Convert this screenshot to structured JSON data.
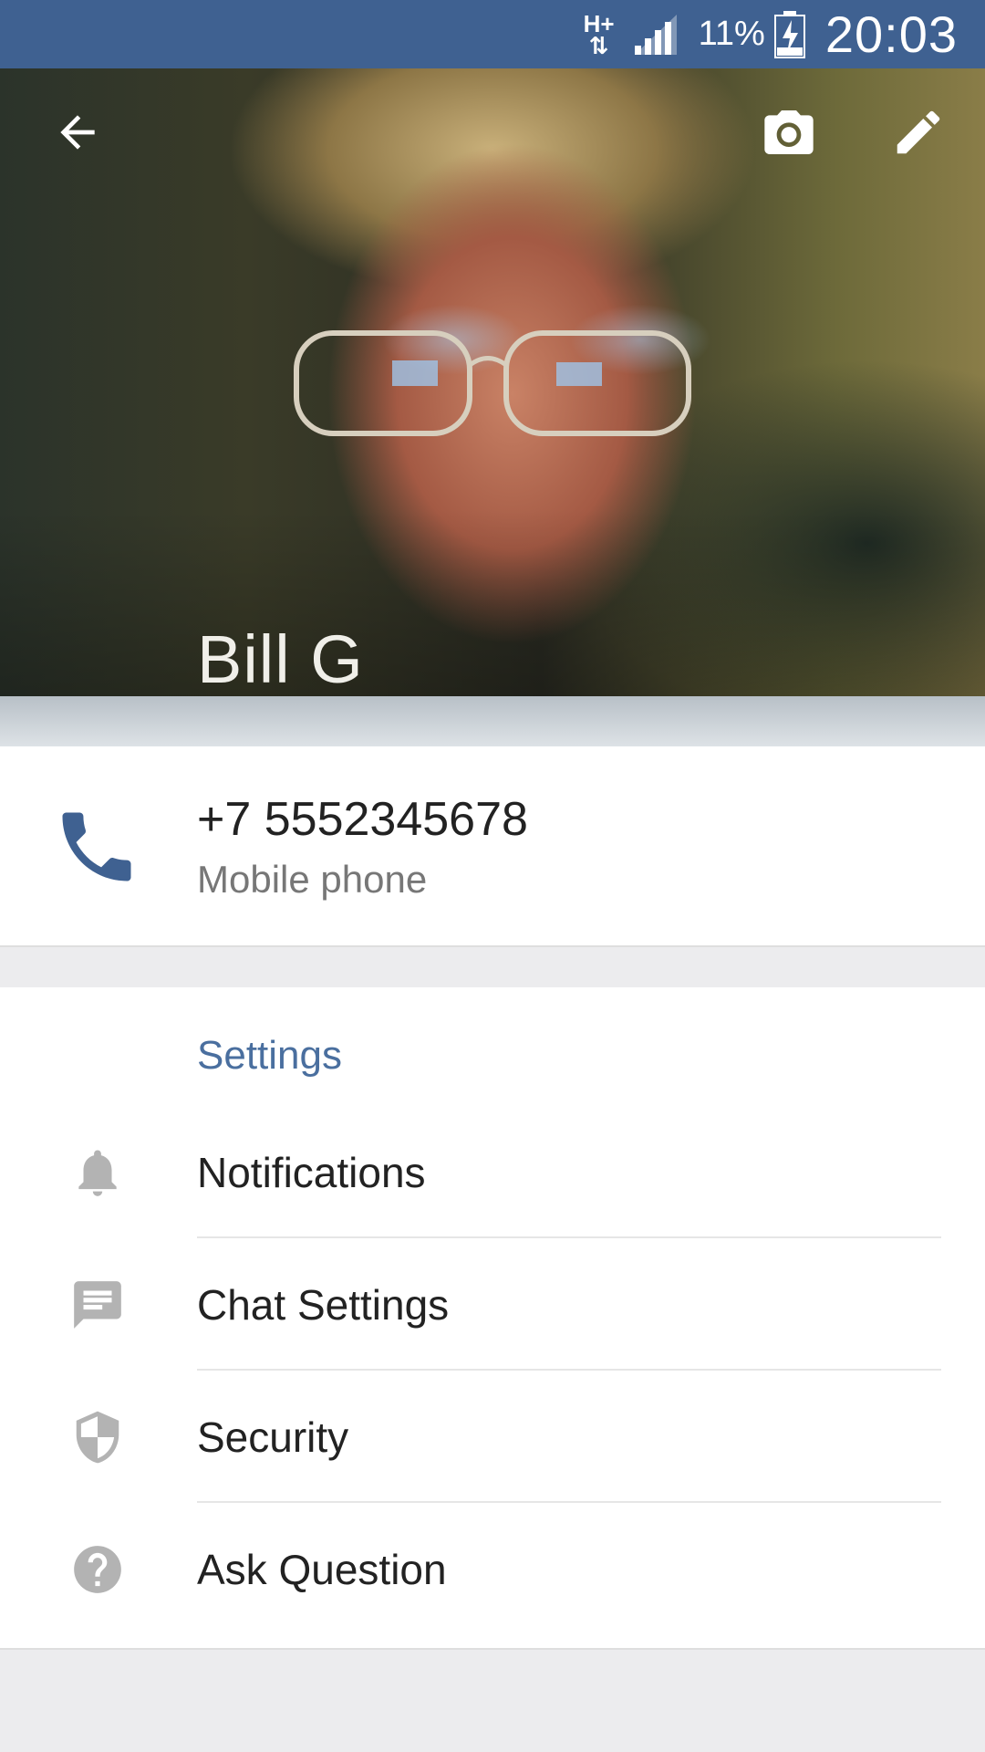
{
  "status_bar": {
    "network": "H+",
    "battery_percent": "11%",
    "time": "20:03"
  },
  "profile": {
    "name": "Bill G",
    "icons": [
      "arrow-back-icon",
      "camera-icon",
      "pencil-icon"
    ]
  },
  "phone": {
    "number": "+7 5552345678",
    "type": "Mobile phone",
    "icon": "phone-icon",
    "accent": "#3f6191"
  },
  "settings": {
    "header": "Settings",
    "items": [
      {
        "label": "Notifications",
        "icon": "bell-icon"
      },
      {
        "label": "Chat Settings",
        "icon": "chat-bubble-icon"
      },
      {
        "label": "Security",
        "icon": "shield-icon"
      },
      {
        "label": "Ask Question",
        "icon": "help-icon"
      }
    ]
  },
  "colors": {
    "status_bar": "#3f6191",
    "section_header": "#4a6f9f",
    "icon_grey": "#b3b3b3",
    "background": "#ececee"
  }
}
